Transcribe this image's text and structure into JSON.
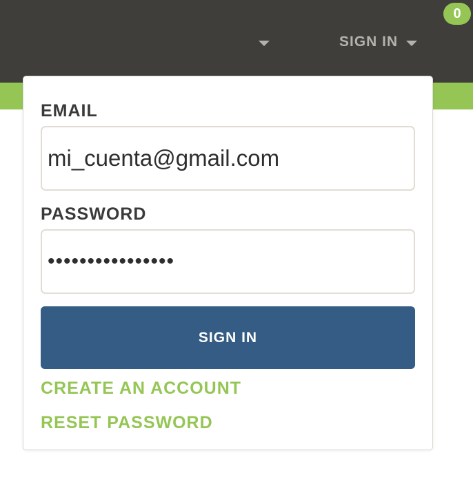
{
  "header": {
    "signin_label": "SIGN IN",
    "cart_count": "0"
  },
  "login_form": {
    "email_label": "EMAIL",
    "email_value": "mi_cuenta@gmail.com",
    "password_label": "PASSWORD",
    "password_value": "••••••••••••••••",
    "submit_label": "SIGN IN",
    "create_account_label": "CREATE AN ACCOUNT",
    "reset_password_label": "RESET PASSWORD"
  },
  "icons": {
    "nav_caret": "caret-down-icon",
    "signin_caret": "caret-down-icon"
  },
  "colors": {
    "header_bg": "#3f3e3a",
    "accent_green": "#95c655",
    "button_blue": "#345c84",
    "nav_text": "#b3b2ab"
  }
}
